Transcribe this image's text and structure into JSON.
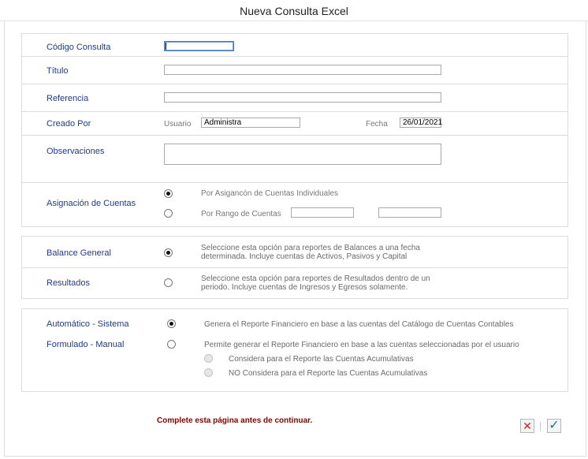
{
  "window": {
    "title": "Nueva Consulta Excel"
  },
  "form": {
    "codigo": {
      "label": "Código Consulta",
      "value": ""
    },
    "titulo": {
      "label": "Título",
      "value": ""
    },
    "referencia": {
      "label": "Referencia",
      "value": ""
    },
    "creado": {
      "label": "Creado Por",
      "usuario_label": "Usuario",
      "usuario_value": "Administra",
      "fecha_label": "Fecha",
      "fecha_value": "26/01/2021"
    },
    "observaciones": {
      "label": "Observaciones",
      "value": ""
    },
    "asignacion": {
      "label": "Asignación de Cuentas",
      "option_individual": "Por Asigancón de Cuentas Individuales",
      "option_rango": "Por Rango de Cuentas",
      "rango_desde": "",
      "rango_hasta": "",
      "selected": "individual"
    }
  },
  "reporte": {
    "balance": {
      "label": "Balance General",
      "desc_line1": "Seleccione esta opción para reportes de Balances a una fecha",
      "desc_line2": "determinada. Incluye cuentas de Activos, Pasivos y Capital",
      "selected": true
    },
    "resultados": {
      "label": "Resultados",
      "desc_line1": "Seleccione esta opción para reportes de Resultados dentro de un",
      "desc_line2": "periodo. Incluye cuentas de Ingresos y Egresos solamente.",
      "selected": false
    }
  },
  "modo": {
    "automatico": {
      "label": "Automático - Sistema",
      "desc": "Genera el Reporte Financiero en base a las cuentas del Catálogo de Cuentas Contables",
      "selected": true
    },
    "formulado": {
      "label": "Formulado - Manual",
      "desc": "Permite generar el Reporte Financiero en base a las cuentas seleccionadas por el usuario",
      "selected": false
    },
    "considera": "Considera para el Reporte las Cuentas Acumulativas",
    "no_considera": "NO Considera para el Reporte las Cuentas Acumulativas"
  },
  "footer": {
    "message": "Complete esta página antes de continuar.",
    "cancel_symbol": "✕",
    "accept_symbol": "✓"
  },
  "colors": {
    "label_blue": "#1f3a8a",
    "message_red": "#8b0000",
    "cancel_red": "#cc1f1f",
    "accept_teal": "#0f7a9c"
  }
}
